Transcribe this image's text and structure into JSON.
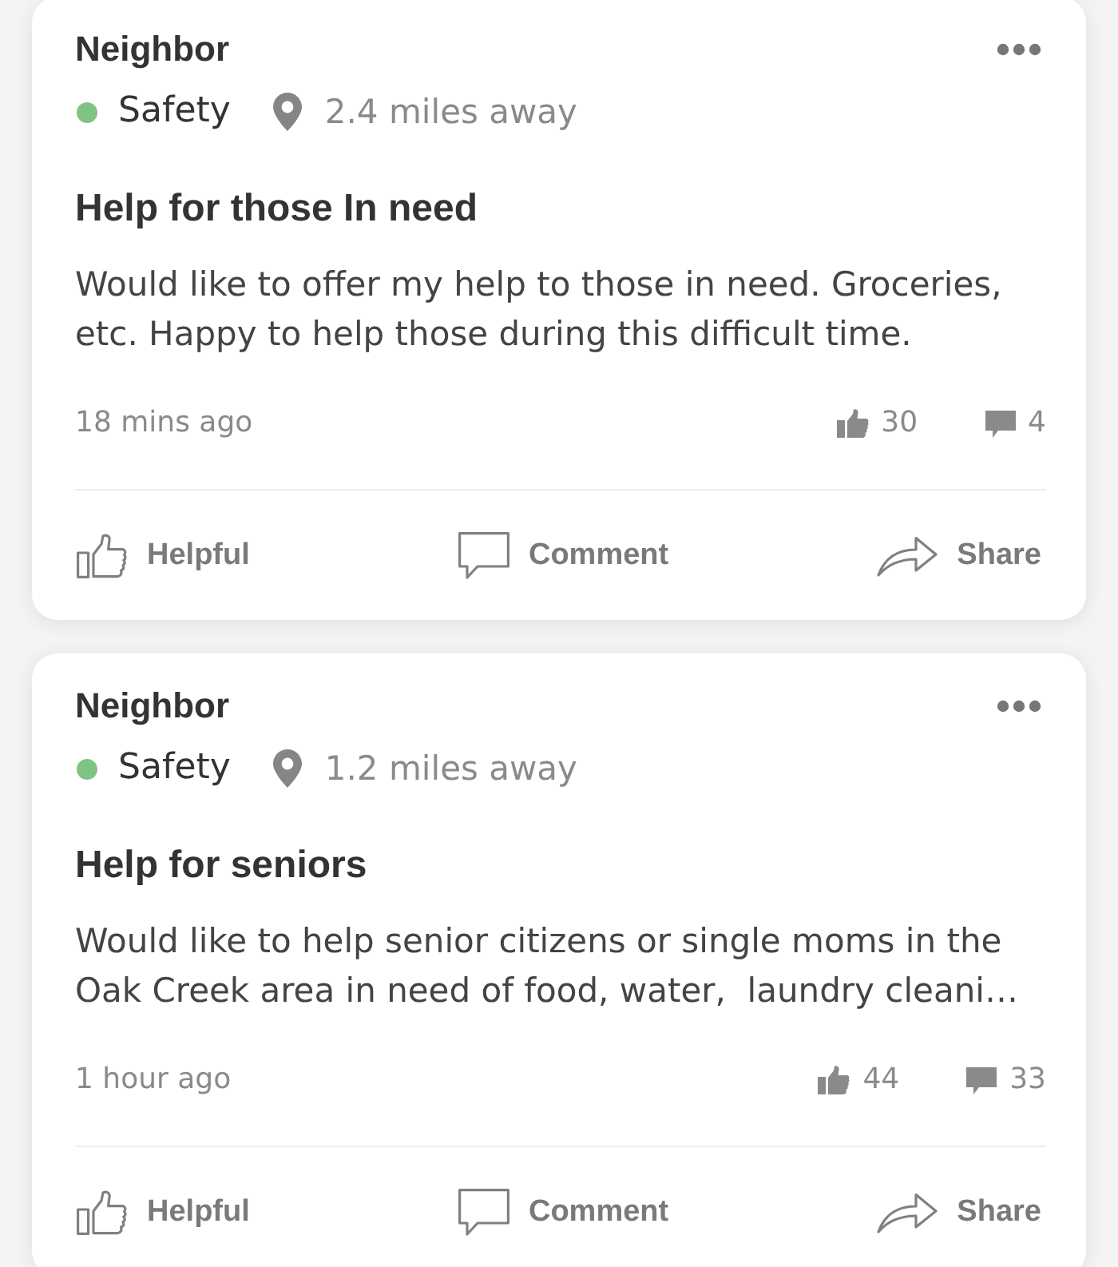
{
  "posts": [
    {
      "author": "Neighbor",
      "category": "Safety",
      "distance": "2.4 miles away",
      "title": "Help for those In need",
      "body": "Would like to offer my help to those in need. Groceries, etc. Happy to help those during this difficult time.",
      "time": "18 mins ago",
      "counts": [
        {
          "kind": "helpful",
          "value": "30"
        },
        {
          "kind": "comments",
          "value": "4"
        }
      ],
      "actions": [
        {
          "kind": "helpful",
          "label": "Helpful"
        },
        {
          "kind": "comment",
          "label": "Comment"
        },
        {
          "kind": "share",
          "label": "Share"
        }
      ]
    },
    {
      "author": "Neighbor",
      "category": "Safety",
      "distance": "1.2 miles away",
      "title": "Help for seniors",
      "body": "Would like to help senior citizens or single moms in the Oak Creek area in need of food, water,  laundry cleani…",
      "time": "1 hour ago",
      "counts": [
        {
          "kind": "helpful",
          "value": "44"
        },
        {
          "kind": "comments",
          "value": "33"
        }
      ],
      "actions": [
        {
          "kind": "helpful",
          "label": "Helpful"
        },
        {
          "kind": "comment",
          "label": "Comment"
        },
        {
          "kind": "share",
          "label": "Share"
        }
      ]
    }
  ]
}
